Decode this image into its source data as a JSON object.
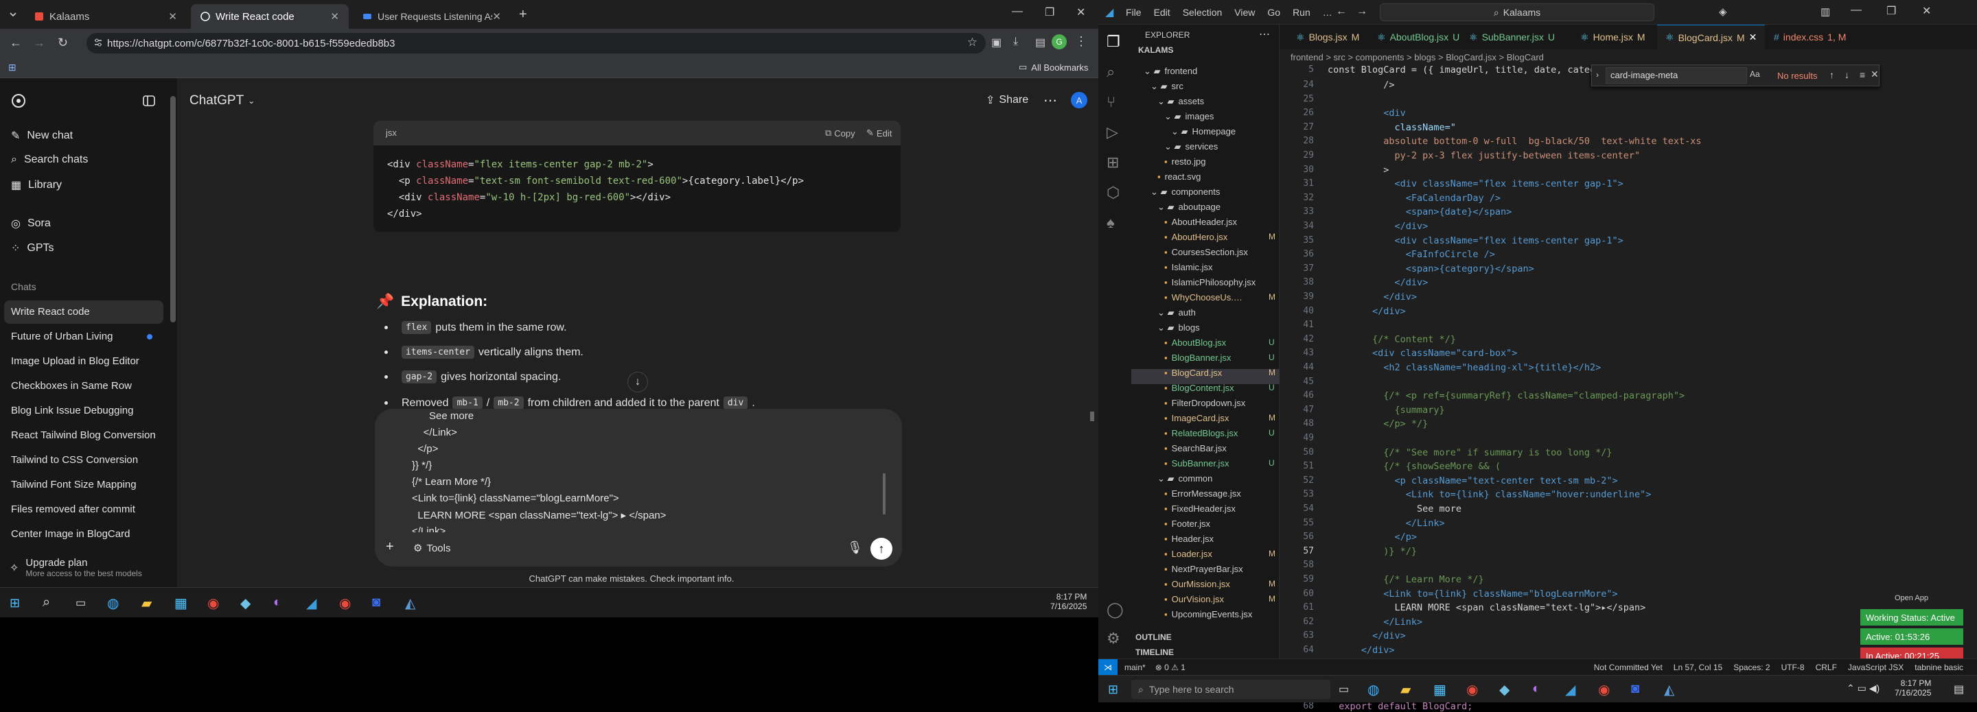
{
  "chrome": {
    "tabs": [
      {
        "title": "Kalaams"
      },
      {
        "title": "Write React code"
      },
      {
        "title": "User Requests Listening Assista"
      }
    ],
    "url": "https://chatgpt.com/c/6877b32f-1c0c-8001-b615-f559ededb8b3",
    "bookmarks_label": "All Bookmarks"
  },
  "chatgpt": {
    "header_title": "ChatGPT",
    "share_label": "Share",
    "avatar_letter": "A",
    "nav": [
      {
        "label": "New chat"
      },
      {
        "label": "Search chats"
      },
      {
        "label": "Library"
      },
      {
        "label": "Sora"
      },
      {
        "label": "GPTs"
      }
    ],
    "chats_heading": "Chats",
    "chats": [
      "Write React code",
      "Future of Urban Living",
      "Image Upload in Blog Editor",
      "Checkboxes in Same Row",
      "Blog Link Issue Debugging",
      "React Tailwind Blog Conversion",
      "Tailwind to CSS Conversion",
      "Tailwind Font Size Mapping",
      "Files removed after commit",
      "Center Image in BlogCard"
    ],
    "upgrade_title": "Upgrade plan",
    "upgrade_sub": "More access to the best models",
    "code_lang": "jsx",
    "copy_label": "Copy",
    "edit_label": "Edit",
    "explanation_title": "Explanation:",
    "bullets": [
      {
        "code": "flex",
        "text": "puts them in the same row."
      },
      {
        "code": "items-center",
        "text": "vertically aligns them."
      },
      {
        "code": "gap-2",
        "text": "gives horizontal spacing."
      },
      {
        "pre": "Removed",
        "code": "mb-1",
        "mid": "/",
        "code2": "mb-2",
        "text": "from children and added it to the parent",
        "code3": "div",
        "end": "."
      }
    ],
    "prompt_lines": [
      "      See more",
      "    </Link>",
      "  </p>",
      "}} */}",
      "{/* Learn More */}",
      "<Link to={link} className=\"blogLearnMore\">",
      "  LEARN MORE <span className=\"text-lg\"> ▸ </span>",
      "</Link>"
    ],
    "tools_label": "Tools",
    "disclaimer": "ChatGPT can make mistakes. Check important info."
  },
  "taskbar_left": {
    "time": "8:17 PM",
    "date": "7/16/2025"
  },
  "vscode": {
    "menu": [
      "File",
      "Edit",
      "Selection",
      "View",
      "Go",
      "Run",
      "…"
    ],
    "search_text": "Kalaams",
    "explorer_title": "EXPLORER",
    "root": "KALAMS",
    "tree": [
      {
        "label": "frontend",
        "lvl": 1,
        "folder": true
      },
      {
        "label": "src",
        "lvl": 2,
        "folder": true
      },
      {
        "label": "assets",
        "lvl": 3,
        "folder": true
      },
      {
        "label": "images",
        "lvl": 4,
        "folder": true
      },
      {
        "label": "Homepage",
        "lvl": 5,
        "folder": true
      },
      {
        "label": "services",
        "lvl": 4,
        "folder": true
      },
      {
        "label": "resto.jpg",
        "lvl": 4
      },
      {
        "label": "react.svg",
        "lvl": 3
      },
      {
        "label": "components",
        "lvl": 2,
        "folder": true
      },
      {
        "label": "aboutpage",
        "lvl": 3,
        "folder": true
      },
      {
        "label": "AboutHeader.jsx",
        "lvl": 4
      },
      {
        "label": "AboutHero.jsx",
        "lvl": 4,
        "badge": "M"
      },
      {
        "label": "CoursesSection.jsx",
        "lvl": 4
      },
      {
        "label": "Islamic.jsx",
        "lvl": 4
      },
      {
        "label": "IslamicPhilosophy.jsx",
        "lvl": 4
      },
      {
        "label": "WhyChooseUs.…",
        "lvl": 4,
        "badge": "M"
      },
      {
        "label": "auth",
        "lvl": 3,
        "folder": true
      },
      {
        "label": "blogs",
        "lvl": 3,
        "folder": true
      },
      {
        "label": "AboutBlog.jsx",
        "lvl": 4,
        "badge": "U"
      },
      {
        "label": "BlogBanner.jsx",
        "lvl": 4,
        "badge": "U"
      },
      {
        "label": "BlogCard.jsx",
        "lvl": 4,
        "badge": "M"
      },
      {
        "label": "BlogContent.jsx",
        "lvl": 4,
        "badge": "U"
      },
      {
        "label": "FilterDropdown.jsx",
        "lvl": 4
      },
      {
        "label": "ImageCard.jsx",
        "lvl": 4,
        "badge": "M"
      },
      {
        "label": "RelatedBlogs.jsx",
        "lvl": 4,
        "badge": "U"
      },
      {
        "label": "SearchBar.jsx",
        "lvl": 4
      },
      {
        "label": "SubBanner.jsx",
        "lvl": 4,
        "badge": "U"
      },
      {
        "label": "common",
        "lvl": 3,
        "folder": true
      },
      {
        "label": "ErrorMessage.jsx",
        "lvl": 4
      },
      {
        "label": "FixedHeader.jsx",
        "lvl": 4
      },
      {
        "label": "Footer.jsx",
        "lvl": 4
      },
      {
        "label": "Header.jsx",
        "lvl": 4
      },
      {
        "label": "Loader.jsx",
        "lvl": 4,
        "badge": "M"
      },
      {
        "label": "NextPrayerBar.jsx",
        "lvl": 4
      },
      {
        "label": "OurMission.jsx",
        "lvl": 4,
        "badge": "M"
      },
      {
        "label": "OurVision.jsx",
        "lvl": 4,
        "badge": "M"
      },
      {
        "label": "UpcomingEvents.jsx",
        "lvl": 4
      }
    ],
    "outline_label": "OUTLINE",
    "timeline_label": "TIMELINE",
    "tabs": [
      {
        "label": "Blogs.jsx",
        "badge": "M"
      },
      {
        "label": "AboutBlog.jsx",
        "badge": "U"
      },
      {
        "label": "SubBanner.jsx",
        "badge": "U"
      },
      {
        "label": "Home.jsx",
        "badge": "M"
      },
      {
        "label": "BlogCard.jsx",
        "badge": "M"
      },
      {
        "label": "index.css",
        "badge": "1, M"
      }
    ],
    "breadcrumb": "frontend > src > components > blogs > BlogCard.jsx > BlogCard",
    "sticky_line": {
      "num": "5",
      "text": "const BlogCard = ({ imageUrl, title, date, categor"
    },
    "find_text": "card-image-meta",
    "find_result": "No results",
    "lines": [
      {
        "n": "24",
        "t": "          />"
      },
      {
        "n": "25",
        "t": ""
      },
      {
        "n": "26",
        "t": "          <div"
      },
      {
        "n": "27",
        "t": "            className=\""
      },
      {
        "n": "28",
        "t": "          absolute bottom-0 w-full  bg-black/50  text-white text-xs"
      },
      {
        "n": "29",
        "t": "            py-2 px-3 flex justify-between items-center\""
      },
      {
        "n": "30",
        "t": "          >"
      },
      {
        "n": "31",
        "t": "            <div className=\"flex items-center gap-1\">"
      },
      {
        "n": "32",
        "t": "              <FaCalendarDay />"
      },
      {
        "n": "33",
        "t": "              <span>{date}</span>"
      },
      {
        "n": "34",
        "t": "            </div>"
      },
      {
        "n": "35",
        "t": "            <div className=\"flex items-center gap-1\">"
      },
      {
        "n": "36",
        "t": "              <FaInfoCircle />"
      },
      {
        "n": "37",
        "t": "              <span>{category}</span>"
      },
      {
        "n": "38",
        "t": "            </div>"
      },
      {
        "n": "39",
        "t": "          </div>"
      },
      {
        "n": "40",
        "t": "        </div>"
      },
      {
        "n": "41",
        "t": ""
      },
      {
        "n": "42",
        "t": "        {/* Content */}"
      },
      {
        "n": "43",
        "t": "        <div className=\"card-box\">"
      },
      {
        "n": "44",
        "t": "          <h2 className=\"heading-xl\">{title}</h2>"
      },
      {
        "n": "45",
        "t": ""
      },
      {
        "n": "46",
        "t": "          {/* <p ref={summaryRef} className=\"clamped-paragraph\">"
      },
      {
        "n": "47",
        "t": "            {summary}"
      },
      {
        "n": "48",
        "t": "          </p> */}"
      },
      {
        "n": "49",
        "t": ""
      },
      {
        "n": "50",
        "t": "          {/* \"See more\" if summary is too long */}"
      },
      {
        "n": "51",
        "t": "          {/* {showSeeMore && ("
      },
      {
        "n": "52",
        "t": "            <p className=\"text-center text-sm mb-2\">"
      },
      {
        "n": "53",
        "t": "              <Link to={link} className=\"hover:underline\">"
      },
      {
        "n": "54",
        "t": "                See more"
      },
      {
        "n": "55",
        "t": "              </Link>"
      },
      {
        "n": "56",
        "t": "            </p>"
      },
      {
        "n": "57",
        "t": "          )} */}"
      },
      {
        "n": "58",
        "t": ""
      },
      {
        "n": "59",
        "t": "          {/* Learn More */}"
      },
      {
        "n": "60",
        "t": "          <Link to={link} className=\"blogLearnMore\">"
      },
      {
        "n": "61",
        "t": "            LEARN MORE <span className=\"text-lg\">▸</span>"
      },
      {
        "n": "62",
        "t": "          </Link>"
      },
      {
        "n": "63",
        "t": "        </div>"
      },
      {
        "n": "64",
        "t": "      </div>"
      },
      {
        "n": "65",
        "t": "    );"
      },
      {
        "n": "66",
        "t": "  };"
      },
      {
        "n": "67",
        "t": ""
      },
      {
        "n": "68",
        "t": "  export default BlogCard;"
      }
    ],
    "status": {
      "branch": "main*",
      "problems": "⊗ 0 ⚠ 1",
      "not_committed": "Not Committed Yet",
      "cursor": "Ln 57, Col 15",
      "spaces": "Spaces: 2",
      "encoding": "UTF-8",
      "eol": "CRLF",
      "language": "JavaScript JSX",
      "extra": "tabnine basic"
    },
    "open_app": "Open App",
    "working_status": "Working Status: Active",
    "active_time": "Active: 01:53:26",
    "inactive_time": "In Active: 00:21:25"
  },
  "taskbar_right": {
    "search": "Type here to search",
    "time": "8:17 PM",
    "date": "7/16/2025"
  }
}
